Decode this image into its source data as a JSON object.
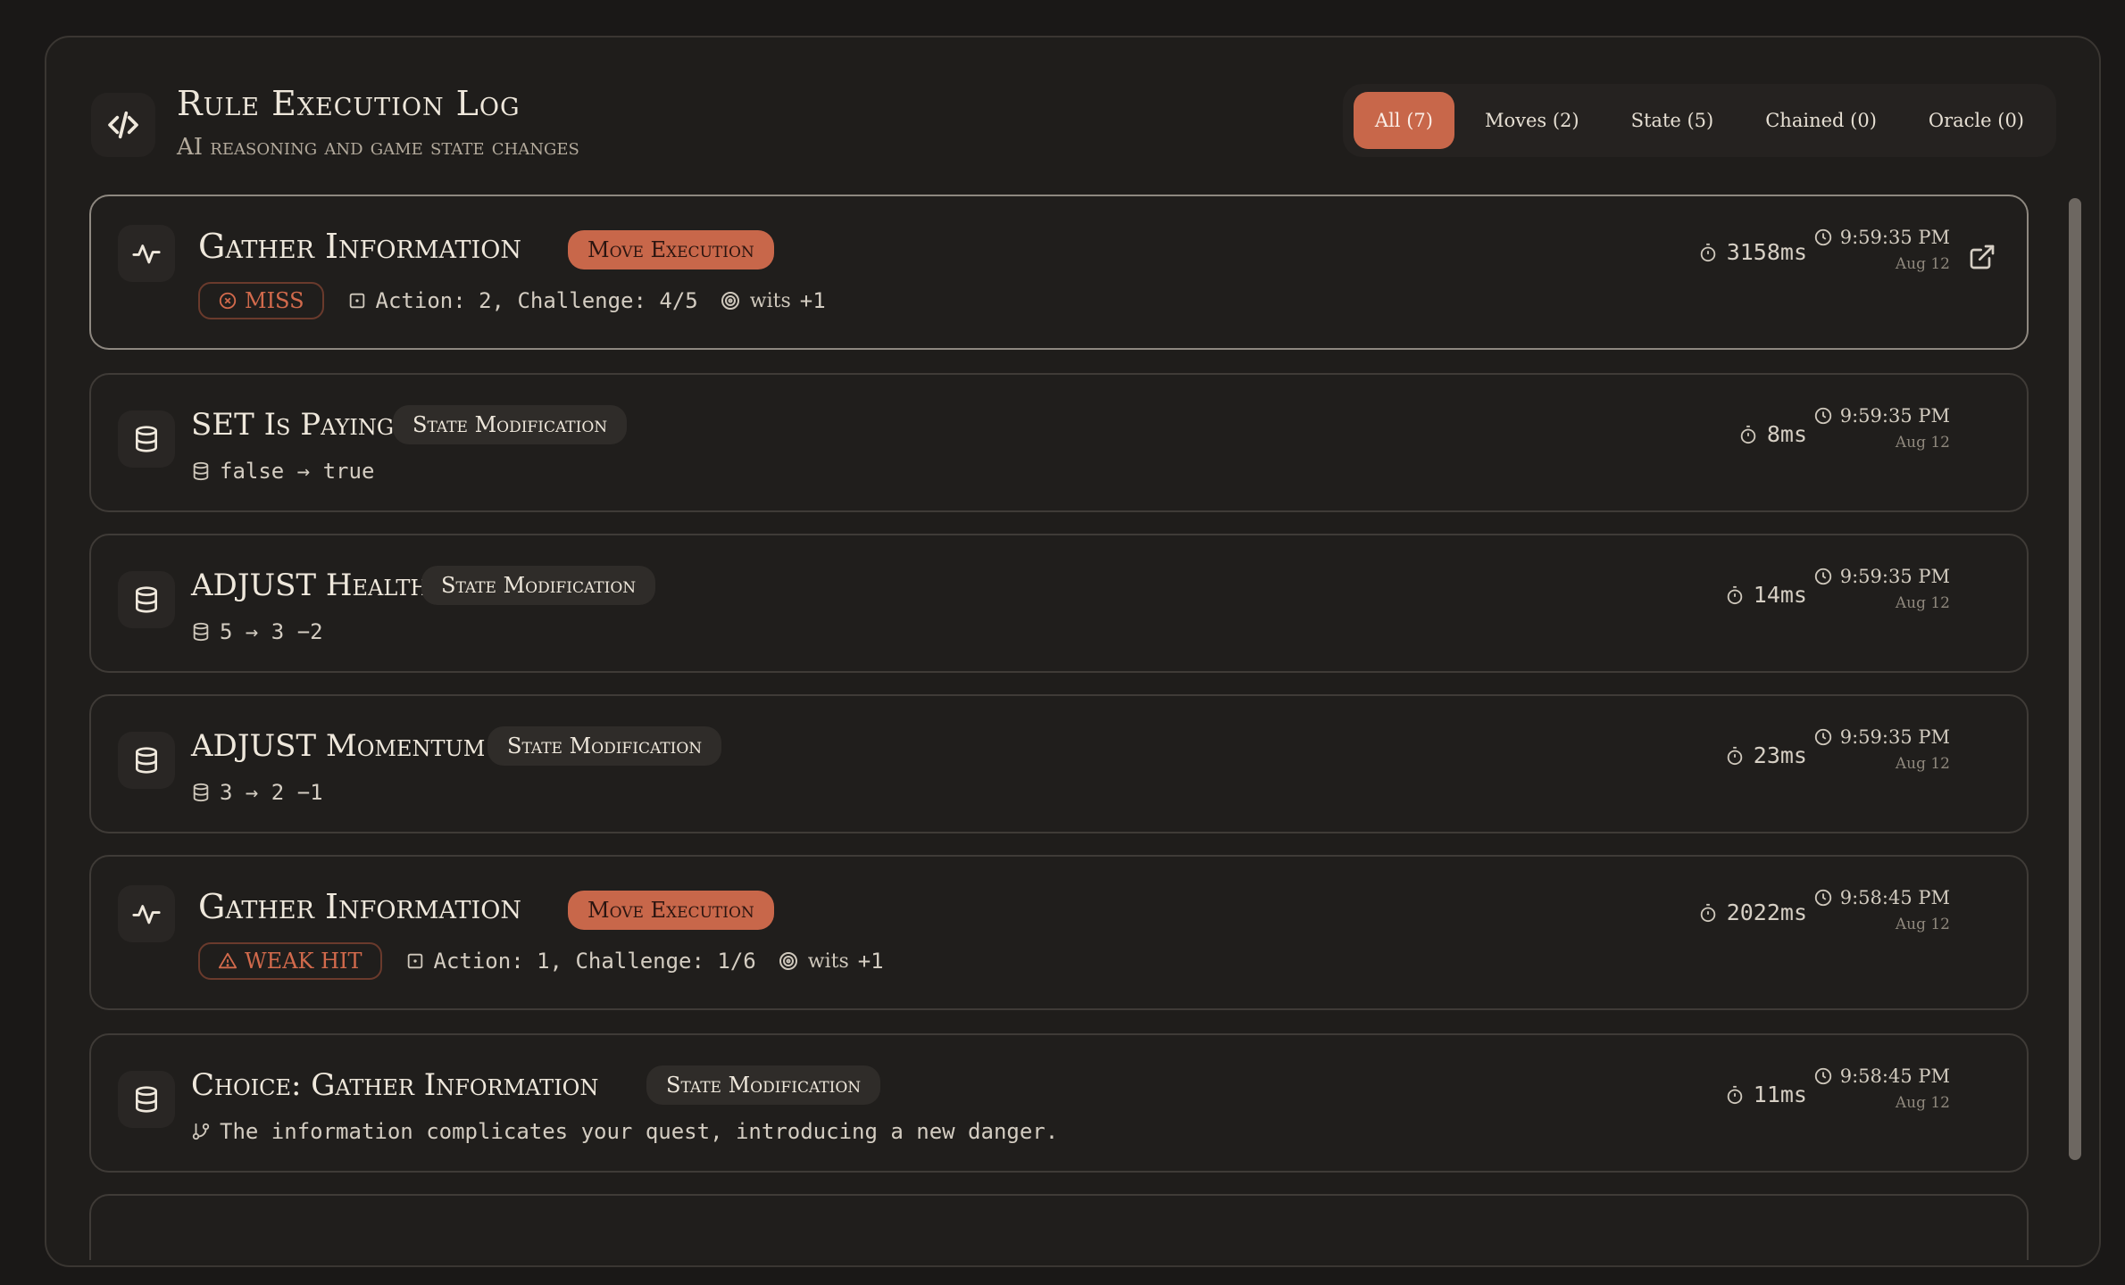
{
  "header": {
    "title": "Rule Execution Log",
    "subtitle": "AI reasoning and game state changes"
  },
  "filters": [
    {
      "label": "All (7)",
      "active": true
    },
    {
      "label": "Moves (2)",
      "active": false
    },
    {
      "label": "State (5)",
      "active": false
    },
    {
      "label": "Chained (0)",
      "active": false
    },
    {
      "label": "Oracle (0)",
      "active": false
    }
  ],
  "entries": [
    {
      "icon": "activity-icon",
      "title": "Gather Information",
      "tag": "Move Execution",
      "outcome": "MISS",
      "outcome_icon": "x-circle-icon",
      "roll": "Action: 2, Challenge: 4/5",
      "stat_name": "wits",
      "stat_value": "+1",
      "duration": "3158ms",
      "time": "9:59:35 PM",
      "date": "Aug 12"
    },
    {
      "icon": "database-icon",
      "title": "SET Is Paying",
      "tag": "State Modification",
      "detail": "false → true",
      "duration": "8ms",
      "time": "9:59:35 PM",
      "date": "Aug 12"
    },
    {
      "icon": "database-icon",
      "title": "ADJUST Health",
      "tag": "State Modification",
      "detail": "5 → 3  −2",
      "duration": "14ms",
      "time": "9:59:35 PM",
      "date": "Aug 12"
    },
    {
      "icon": "database-icon",
      "title": "ADJUST Momentum",
      "tag": "State Modification",
      "detail": "3 → 2  −1",
      "duration": "23ms",
      "time": "9:59:35 PM",
      "date": "Aug 12"
    },
    {
      "icon": "activity-icon",
      "title": "Gather Information",
      "tag": "Move Execution",
      "outcome": "WEAK HIT",
      "outcome_icon": "alert-triangle-icon",
      "roll": "Action: 1, Challenge: 1/6",
      "stat_name": "wits",
      "stat_value": "+1",
      "duration": "2022ms",
      "time": "9:58:45 PM",
      "date": "Aug 12"
    },
    {
      "icon": "database-icon",
      "title": "Choice: Gather Information",
      "tag": "State Modification",
      "detail": "The information complicates your quest, introducing a new danger.",
      "duration": "11ms",
      "time": "9:58:45 PM",
      "date": "Aug 12"
    }
  ]
}
